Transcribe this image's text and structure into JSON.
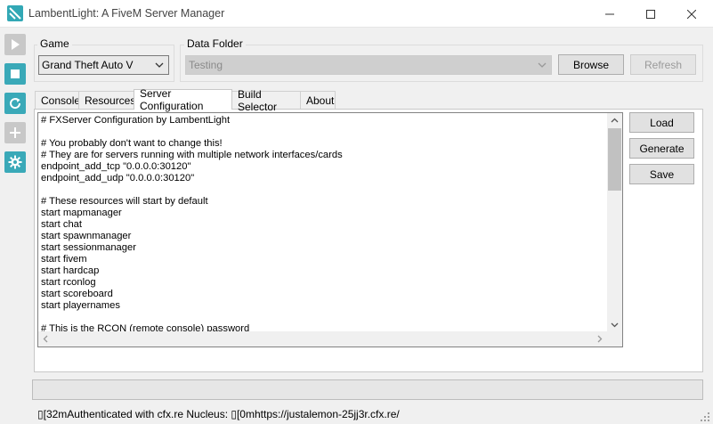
{
  "window": {
    "title": "LambentLight: A FiveM Server Manager",
    "accent": "#3aa9b8"
  },
  "sidebar": {
    "items": [
      {
        "icon": "play-icon",
        "enabled": false
      },
      {
        "icon": "stop-icon",
        "enabled": true
      },
      {
        "icon": "refresh-icon",
        "enabled": true
      },
      {
        "icon": "plus-icon",
        "enabled": false
      },
      {
        "icon": "gear-icon",
        "enabled": true
      }
    ]
  },
  "game": {
    "label": "Game",
    "selected": "Grand Theft Auto V"
  },
  "data_folder": {
    "label": "Data Folder",
    "selected": "Testing",
    "browse_label": "Browse",
    "refresh_label": "Refresh"
  },
  "tabs": [
    {
      "label": "Console",
      "active": false
    },
    {
      "label": "Resources",
      "active": false
    },
    {
      "label": "Server Configuration",
      "active": true
    },
    {
      "label": "Build Selector",
      "active": false
    },
    {
      "label": "About",
      "active": false
    }
  ],
  "config": {
    "lines": [
      "# FXServer Configuration by LambentLight",
      "",
      "# You probably don't want to change this!",
      "# They are for servers running with multiple network interfaces/cards",
      "endpoint_add_tcp \"0.0.0.0:30120\"",
      "endpoint_add_udp \"0.0.0.0:30120\"",
      "",
      "# These resources will start by default",
      "start mapmanager",
      "start chat",
      "start spawnmanager",
      "start sessionmanager",
      "start fivem",
      "start hardcap",
      "start rconlog",
      "start scoreboard",
      "start playernames",
      "",
      "# This is the RCON (remote console) password"
    ],
    "load_label": "Load",
    "generate_label": "Generate",
    "save_label": "Save"
  },
  "status": {
    "progress": 0,
    "message": "▯[32mAuthenticated with cfx.re Nucleus: ▯[0mhttps://justalemon-25jj3r.cfx.re/"
  }
}
